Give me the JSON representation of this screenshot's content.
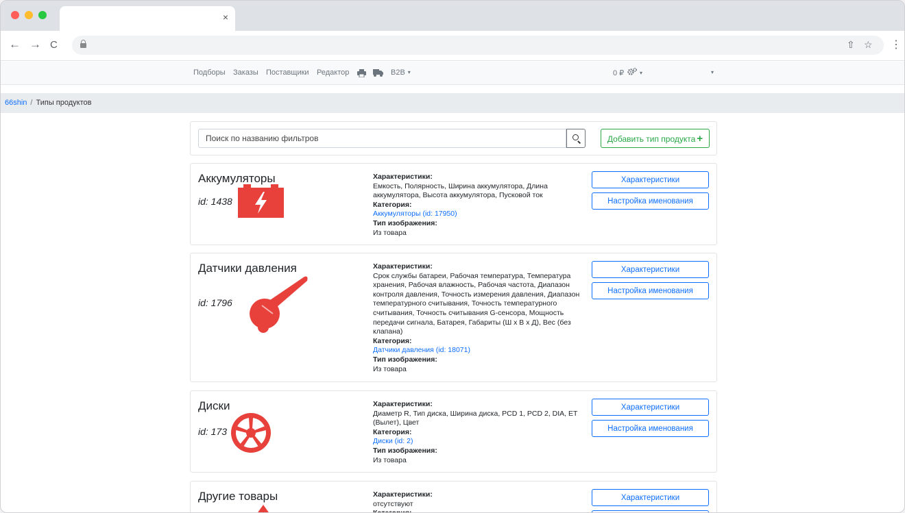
{
  "browser": {
    "tab_close": "×",
    "icons": {
      "back": "←",
      "forward": "→",
      "reload": "C",
      "share": "⇧",
      "star": "☆",
      "menu": "⋮"
    }
  },
  "site_nav": {
    "items": [
      "Подборы",
      "Заказы",
      "Поставщики",
      "Редактор"
    ],
    "b2b_label": "B2B",
    "balance": "0 ₽"
  },
  "breadcrumb": {
    "home": "66shin",
    "separator": "/",
    "current": "Типы продуктов"
  },
  "search": {
    "placeholder": "Поиск по названию фильтров",
    "add_label": "Добавить тип продукта",
    "add_icon": "+"
  },
  "labels": {
    "characteristics": "Характеристики:",
    "category": "Категория:",
    "image_type": "Тип изображения:",
    "btn_characteristics": "Характеристики",
    "btn_naming": "Настройка именования"
  },
  "products": [
    {
      "name": "Аккумуляторы",
      "id_text": "id: 1438",
      "characteristics": "Емкость, Полярность, Ширина аккумулятора, Длина аккумулятора, Высота аккумулятора, Пусковой ток",
      "category": "Аккумуляторы (id: 17950)",
      "image_type": "Из товара",
      "icon": "battery-icon"
    },
    {
      "name": "Датчики давления",
      "id_text": "id: 1796",
      "characteristics": "Срок службы батареи, Рабочая температура, Температура хранения, Рабочая влажность, Рабочая частота, Диапазон контроля давления, Точность измерения давления, Диапазон температурного считывания, Точность температурного считывания, Точность считывания G-сенсора, Мощность передачи сигнала, Батарея, Габариты (Ш х В х Д), Вес (без клапана)",
      "category": "Датчики давления (id: 18071)",
      "image_type": "Из товара",
      "icon": "pressure-sensor-icon"
    },
    {
      "name": "Диски",
      "id_text": "id: 173",
      "characteristics": "Диаметр R, Тип диска, Ширина диска, PCD 1, PCD 2, DIA, ET (Вылет), Цвет",
      "category": "Диски (id: 2)",
      "image_type": "Из товара",
      "icon": "wheel-icon"
    },
    {
      "name": "Другие товары",
      "characteristics": "отсутствуют",
      "icon": "drop-icon"
    }
  ],
  "colors": {
    "primary": "#0d6efd",
    "success": "#28a745",
    "icon_red": "#e8403a"
  }
}
